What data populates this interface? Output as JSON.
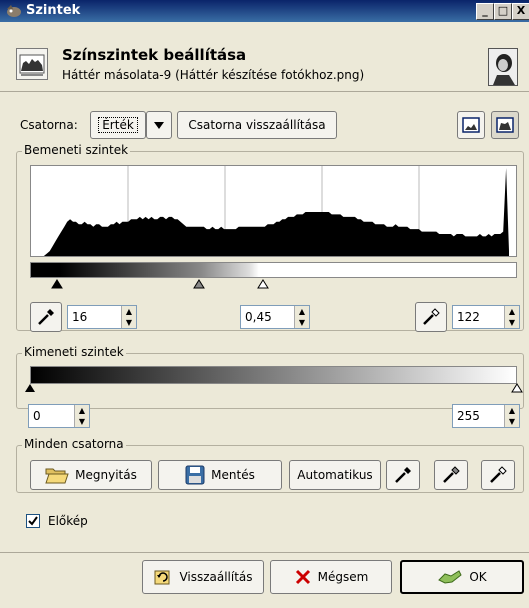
{
  "window": {
    "title": "Szintek",
    "minimize": "_",
    "maximize": "□",
    "close": "X"
  },
  "header": {
    "title": "Színszintek beállítása",
    "subtitle": "Háttér másolata-9 (Háttér készítése fotókhoz.png)"
  },
  "channel": {
    "label": "Csatorna:",
    "value": "Érték",
    "reset_label": "Csatorna visszaállítása"
  },
  "input_levels": {
    "label": "Bemeneti szintek",
    "low": "16",
    "gamma": "0,45",
    "high": "122",
    "histogram": [
      0,
      0,
      1,
      2,
      4,
      6,
      8,
      10,
      12,
      14,
      15,
      14,
      14,
      13,
      13,
      14,
      13,
      13,
      12,
      13,
      13,
      12,
      12,
      12,
      13,
      13,
      14,
      13,
      14,
      14,
      14,
      15,
      15,
      15,
      16,
      15,
      16,
      15,
      16,
      15,
      15,
      16,
      16,
      15,
      16,
      16,
      15,
      15,
      14,
      13,
      12,
      12,
      12,
      12,
      12,
      12,
      12,
      11,
      11,
      12,
      11,
      11,
      12,
      11,
      11,
      11,
      11,
      11,
      12,
      12,
      12,
      12,
      12,
      12,
      12,
      12,
      12,
      12,
      13,
      13,
      13,
      14,
      14,
      15,
      15,
      16,
      16,
      16,
      17,
      17,
      17,
      18,
      18,
      18,
      18,
      18,
      18,
      18,
      18,
      18,
      17,
      17,
      17,
      17,
      16,
      16,
      16,
      16,
      16,
      15,
      15,
      14,
      14,
      14,
      14,
      13,
      13,
      13,
      13,
      12,
      12,
      12,
      13,
      12,
      12,
      12,
      12,
      11,
      11,
      11,
      11,
      10,
      10,
      10,
      10,
      10,
      10,
      9,
      9,
      9,
      9,
      9,
      8,
      9,
      9,
      9,
      8,
      8,
      8,
      8,
      8,
      9,
      8,
      8,
      9,
      8,
      9,
      9,
      9,
      10,
      36,
      2
    ]
  },
  "output_levels": {
    "label": "Kimeneti szintek",
    "low": "0",
    "high": "255"
  },
  "all_channels": {
    "label": "Minden csatorna",
    "open_label": "Megnyitás",
    "save_label": "Mentés",
    "auto_label": "Automatikus"
  },
  "preview": {
    "label": "Előkép",
    "checked": true
  },
  "footer": {
    "reset_label": "Visszaállítás",
    "cancel_label": "Mégsem",
    "ok_label": "OK"
  },
  "colors": {
    "title_bar": "#0a246a",
    "dialog_bg": "#ece9d8"
  }
}
